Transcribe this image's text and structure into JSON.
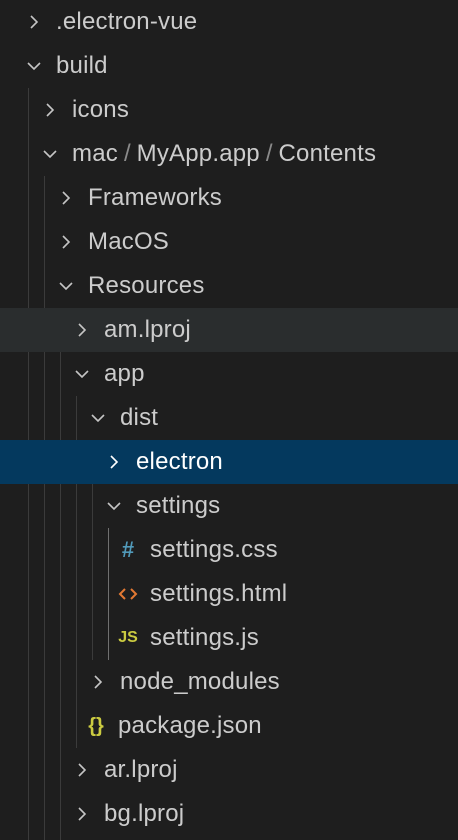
{
  "explorer": {
    "items": [
      {
        "label": "",
        "icon": "chevron-right-icon"
      },
      {
        "label": ".electron-vue",
        "icon": "chevron-right-icon"
      },
      {
        "label": "build",
        "icon": "chevron-down-icon"
      },
      {
        "label": "icons",
        "icon": "chevron-right-icon"
      },
      {
        "path": [
          "mac",
          "MyApp.app",
          "Contents"
        ],
        "separator": "/",
        "icon": "chevron-down-icon"
      },
      {
        "label": "Frameworks",
        "icon": "chevron-right-icon"
      },
      {
        "label": "MacOS",
        "icon": "chevron-right-icon"
      },
      {
        "label": "Resources",
        "icon": "chevron-down-icon"
      },
      {
        "label": "am.lproj",
        "icon": "chevron-right-icon"
      },
      {
        "label": "app",
        "icon": "chevron-down-icon"
      },
      {
        "label": "dist",
        "icon": "chevron-down-icon"
      },
      {
        "label": "electron",
        "icon": "chevron-right-icon",
        "selected": true
      },
      {
        "label": "settings",
        "icon": "chevron-down-icon"
      },
      {
        "label": "settings.css",
        "icon": "css-hash-icon",
        "icon_glyph": "#",
        "icon_color": "#519aba"
      },
      {
        "label": "settings.html",
        "icon": "html-code-icon",
        "icon_glyph": "<>",
        "icon_color": "#e37933"
      },
      {
        "label": "settings.js",
        "icon": "js-file-icon",
        "icon_glyph": "JS",
        "icon_color": "#cbcb41"
      },
      {
        "label": "node_modules",
        "icon": "chevron-right-icon"
      },
      {
        "label": "package.json",
        "icon": "json-braces-icon",
        "icon_glyph": "{}",
        "icon_color": "#cbcb41"
      },
      {
        "label": "ar.lproj",
        "icon": "chevron-right-icon"
      },
      {
        "label": "bg.lproj",
        "icon": "chevron-right-icon"
      }
    ]
  },
  "colors": {
    "background": "#1e1e1e",
    "selected_row": "#04395e",
    "hover_row": "#2a2d2e",
    "text": "#cccccc",
    "twisty": "#c5c5c5"
  }
}
